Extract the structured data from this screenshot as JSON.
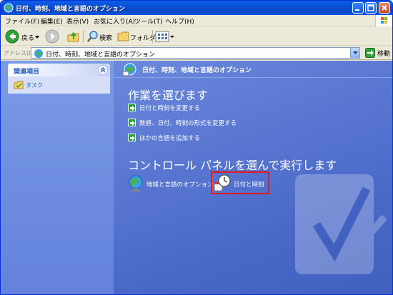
{
  "window": {
    "title": "日付、時刻、地域と言語のオプション"
  },
  "menubar": {
    "items": [
      "ファイル(F)",
      "編集(E)",
      "表示(V)",
      "お気に入り(A)",
      "ツール(T)",
      "ヘルプ(H)"
    ]
  },
  "toolbar": {
    "back_label": "戻る",
    "search_label": "検索",
    "folders_label": "フォルダ"
  },
  "address": {
    "label": "アドレス(D)",
    "value": "日付、時刻、地域と言語のオプション",
    "go_label": "移動"
  },
  "sidebar": {
    "panel_title": "関連項目",
    "items": [
      {
        "label": "タスク"
      }
    ]
  },
  "main": {
    "header": "日付、時刻、地域と言語のオプション",
    "pick_task_heading": "作業を選びます",
    "tasks": [
      {
        "label": "日付と時刻を変更する"
      },
      {
        "label": "数値、日付、時刻の形式を変更する"
      },
      {
        "label": "ほかの言語を追加する"
      }
    ],
    "pick_icon_heading": "コントロール パネルを選んで実行します",
    "icons": [
      {
        "label": "地域と言語のオプション"
      },
      {
        "label": "日付と時刻"
      }
    ]
  },
  "colors": {
    "highlight": "#e21a1a",
    "titlebar": "#0a4fd6",
    "content_bg": "#5a78d4"
  }
}
